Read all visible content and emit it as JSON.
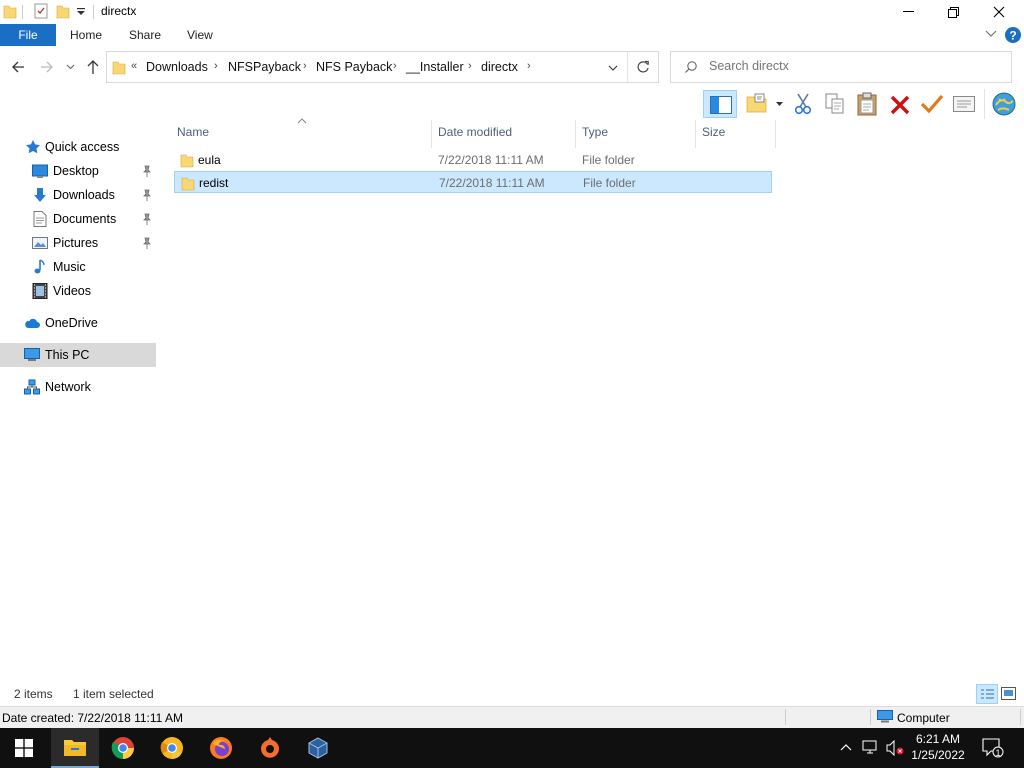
{
  "window": {
    "title": "directx"
  },
  "ribbon": {
    "tabs": [
      "File",
      "Home",
      "Share",
      "View"
    ]
  },
  "address": {
    "overflow": "«",
    "crumbs": [
      "Downloads",
      "NFSPayback",
      "NFS Payback",
      "__Installer",
      "directx"
    ],
    "search_placeholder": "Search directx"
  },
  "nav": {
    "quick_access": "Quick access",
    "items": [
      {
        "label": "Desktop",
        "icon": "desktop-icon",
        "pinned": true
      },
      {
        "label": "Downloads",
        "icon": "downloads-icon",
        "pinned": true
      },
      {
        "label": "Documents",
        "icon": "documents-icon",
        "pinned": true
      },
      {
        "label": "Pictures",
        "icon": "pictures-icon",
        "pinned": true
      },
      {
        "label": "Music",
        "icon": "music-icon",
        "pinned": false
      },
      {
        "label": "Videos",
        "icon": "videos-icon",
        "pinned": false
      }
    ],
    "onedrive": "OneDrive",
    "thispc": "This PC",
    "network": "Network"
  },
  "columns": {
    "name": "Name",
    "date": "Date modified",
    "type": "Type",
    "size": "Size"
  },
  "files": [
    {
      "name": "eula",
      "date": "7/22/2018 11:11 AM",
      "type": "File folder",
      "selected": false
    },
    {
      "name": "redist",
      "date": "7/22/2018 11:11 AM",
      "type": "File folder",
      "selected": true
    }
  ],
  "status": {
    "count": "2 items",
    "selection": "1 item selected",
    "details": "Date created: 7/22/2018 11:11 AM",
    "location": "Computer"
  },
  "taskbar": {
    "time": "6:21 AM",
    "date": "1/25/2022",
    "notification_count": "1"
  },
  "colors": {
    "accent": "#1a6fc4",
    "selection": "#cce8ff",
    "taskbar": "#101010",
    "folder": "#f8d775"
  }
}
